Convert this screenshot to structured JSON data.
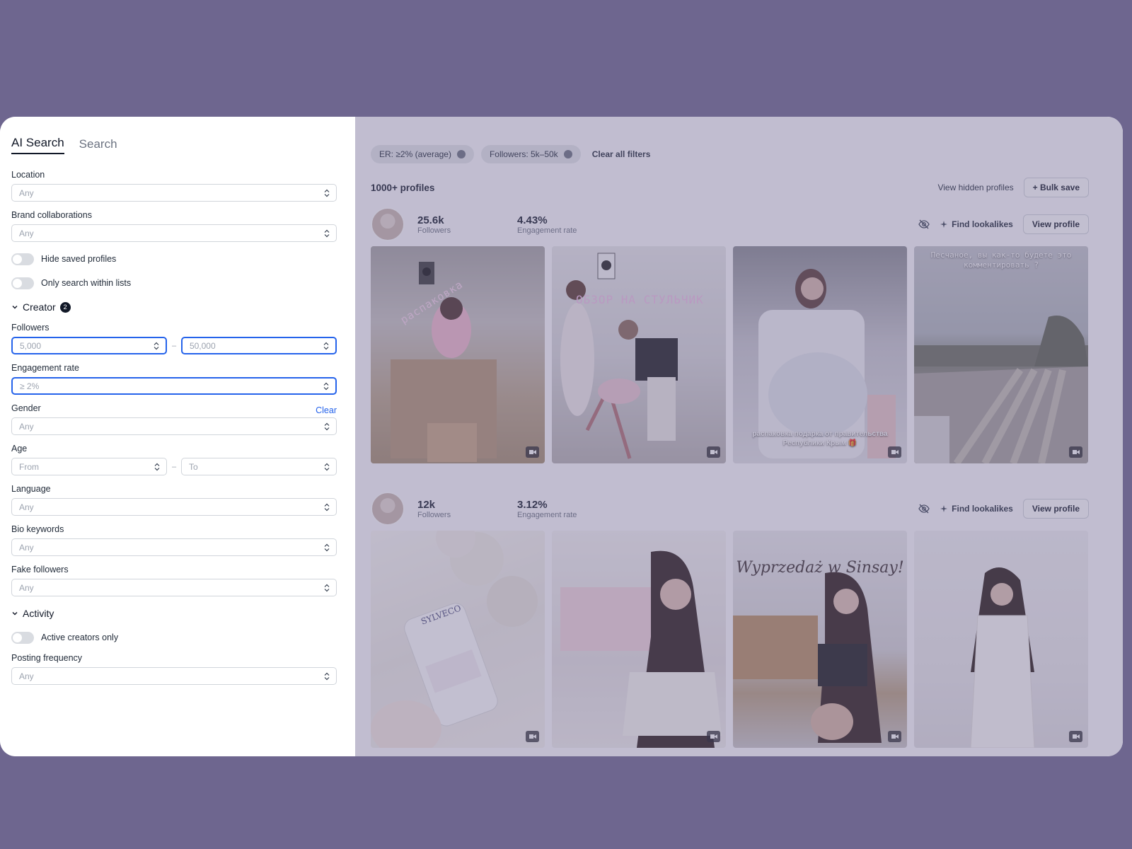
{
  "tabs": [
    {
      "label": "AI Search",
      "active": true
    },
    {
      "label": "Search",
      "active": false
    }
  ],
  "filters": {
    "location": {
      "label": "Location",
      "value": "Any"
    },
    "brand": {
      "label": "Brand collaborations",
      "value": "Any"
    },
    "toggles": [
      {
        "label": "Hide saved profiles",
        "on": false
      },
      {
        "label": "Only search within lists",
        "on": false
      }
    ],
    "creator": {
      "title": "Creator",
      "badge": "2"
    },
    "followers": {
      "label": "Followers",
      "from": "5,000",
      "to": "50,000"
    },
    "engagement": {
      "label": "Engagement rate",
      "value": "≥ 2%"
    },
    "gender": {
      "label": "Gender",
      "clear": "Clear",
      "value": "Any"
    },
    "age": {
      "label": "Age",
      "from": "From",
      "to": "To"
    },
    "language": {
      "label": "Language",
      "value": "Any"
    },
    "bio": {
      "label": "Bio keywords",
      "value": "Any"
    },
    "fake": {
      "label": "Fake followers",
      "value": "Any"
    },
    "activity": {
      "title": "Activity"
    },
    "active_only": {
      "label": "Active creators only",
      "on": false
    },
    "posting": {
      "label": "Posting frequency",
      "value": "Any"
    }
  },
  "chips": [
    {
      "label": "ER: ≥2% (average)"
    },
    {
      "label": "Followers: 5k–50k"
    }
  ],
  "clear_all": "Clear all filters",
  "results": {
    "count": "1000+ profiles",
    "view_hidden": "View hidden profiles",
    "bulk_save": "+ Bulk save"
  },
  "profiles": [
    {
      "followers": "25.6k",
      "followers_label": "Followers",
      "er": "4.43%",
      "er_label": "Engagement rate",
      "find": "Find lookalikes",
      "view": "View profile",
      "posts": [
        {
          "text": "распаковка"
        },
        {
          "text": "ОБЗОР НА СТУЛЬЧИК"
        },
        {
          "text": "распаковка подарка от правительства Республики Крым 🎁"
        },
        {
          "text": "Песчаное, вы как-то будете это комментировать ?"
        }
      ]
    },
    {
      "followers": "12k",
      "followers_label": "Followers",
      "er": "3.12%",
      "er_label": "Engagement rate",
      "find": "Find lookalikes",
      "view": "View profile",
      "posts": [
        {
          "text": "SYLVECO"
        },
        {
          "text": ""
        },
        {
          "text": "Wyprzedaż w Sinsay!"
        },
        {
          "text": ""
        }
      ]
    }
  ],
  "colors": {
    "accent": "#2563eb",
    "backdrop": "#6e668f"
  }
}
